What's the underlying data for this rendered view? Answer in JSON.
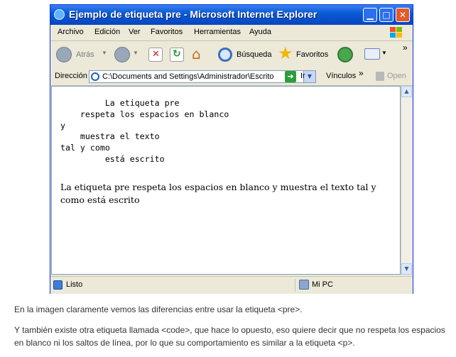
{
  "window": {
    "title": "Ejemplo de etiqueta pre - Microsoft Internet Explorer"
  },
  "menu": [
    "Archivo",
    "Edición",
    "Ver",
    "Favoritos",
    "Herramientas",
    "Ayuda"
  ],
  "toolbar": {
    "back_label": "Atrás",
    "search_label": "Búsqueda",
    "favorites_label": "Favoritos",
    "overflow": "»"
  },
  "address": {
    "label": "Dirección",
    "value": "C:\\Documents and Settings\\Administrador\\Escrito",
    "go_label": "Ir",
    "links_label": "Vínculos",
    "links_overflow": "»",
    "open_label": "Open"
  },
  "content": {
    "pre_text": "         La etiqueta pre\n    respeta los espacios en blanco\ny\n    muestra el texto\ntal y como\n         está escrito",
    "p_text": "La etiqueta pre respeta los espacios en blanco y muestra el texto tal y como está escrito"
  },
  "status": {
    "left": "Listo",
    "zone": "Mi PC"
  },
  "caption": {
    "line1": "En la imagen claramente vemos las diferencias entre usar la etiqueta <pre>.",
    "line2": "Y también existe otra etiqueta llamada <code>, que hace lo opuesto, eso quiere decir que no respeta los espacios en blanco ni los saltos de línea, por lo que su comportamiento es similar a la etiqueta <p>."
  },
  "colors": {
    "titlebar": "#0a5bd6",
    "close_button": "#e35a2b",
    "chrome": "#ece9d8"
  }
}
